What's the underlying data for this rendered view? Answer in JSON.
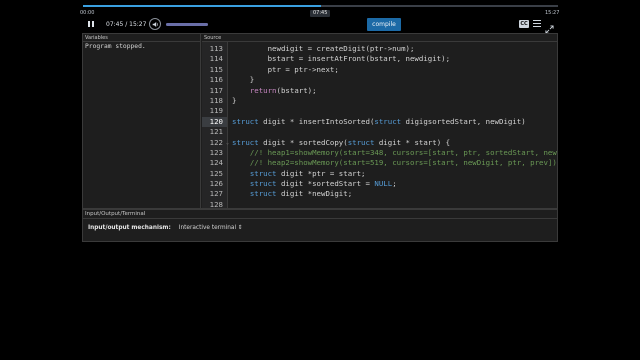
{
  "player": {
    "start_time": "00:00",
    "end_time": "15:27",
    "seek_tooltip": "07:45",
    "time_readout": "07:45 / 15:27",
    "progress_fraction": 0.5,
    "volume_fraction": 1.0,
    "compile_label": "compile",
    "cc_label": "CC",
    "accent_color": "#3aa0e0",
    "compile_color": "#1c6aa6"
  },
  "variables": {
    "header": "Variables",
    "content": "Program stopped."
  },
  "source": {
    "header": "Source",
    "current_line": "120",
    "lines": [
      {
        "n": "113",
        "text": "        newdigit = createDigit(ptr->num);"
      },
      {
        "n": "114",
        "text": "        bstart = insertAtFront(bstart, newdigit);"
      },
      {
        "n": "115",
        "text": "        ptr = ptr->next;"
      },
      {
        "n": "116",
        "text": "    }"
      },
      {
        "n": "117",
        "text": "    return(bstart);"
      },
      {
        "n": "118",
        "text": "}"
      },
      {
        "n": "119",
        "text": ""
      },
      {
        "n": "120",
        "text": "struct digit * insertIntoSorted(struct digigsortedStart, newDigit)"
      },
      {
        "n": "121",
        "text": ""
      },
      {
        "n": "122",
        "text": "struct digit * sortedCopy(struct digit * start) {"
      },
      {
        "n": "123",
        "text": "    //! heap1=showMemory(start=348, cursors=[start, ptr, sortedStart, newDigit])"
      },
      {
        "n": "124",
        "text": "    //! heap2=showMemory(start=519, cursors=[start, newDigit, ptr, prev])"
      },
      {
        "n": "125",
        "text": "    struct digit *ptr = start;"
      },
      {
        "n": "126",
        "text": "    struct digit *sortedStart = NULL;"
      },
      {
        "n": "127",
        "text": "    struct digit *newDigit;"
      },
      {
        "n": "128",
        "text": ""
      }
    ]
  },
  "terminal": {
    "header": "Input/Output/Terminal",
    "mechanism_label": "Input/output mechanism:",
    "mechanism_value": "Interactive terminal ⇕"
  }
}
